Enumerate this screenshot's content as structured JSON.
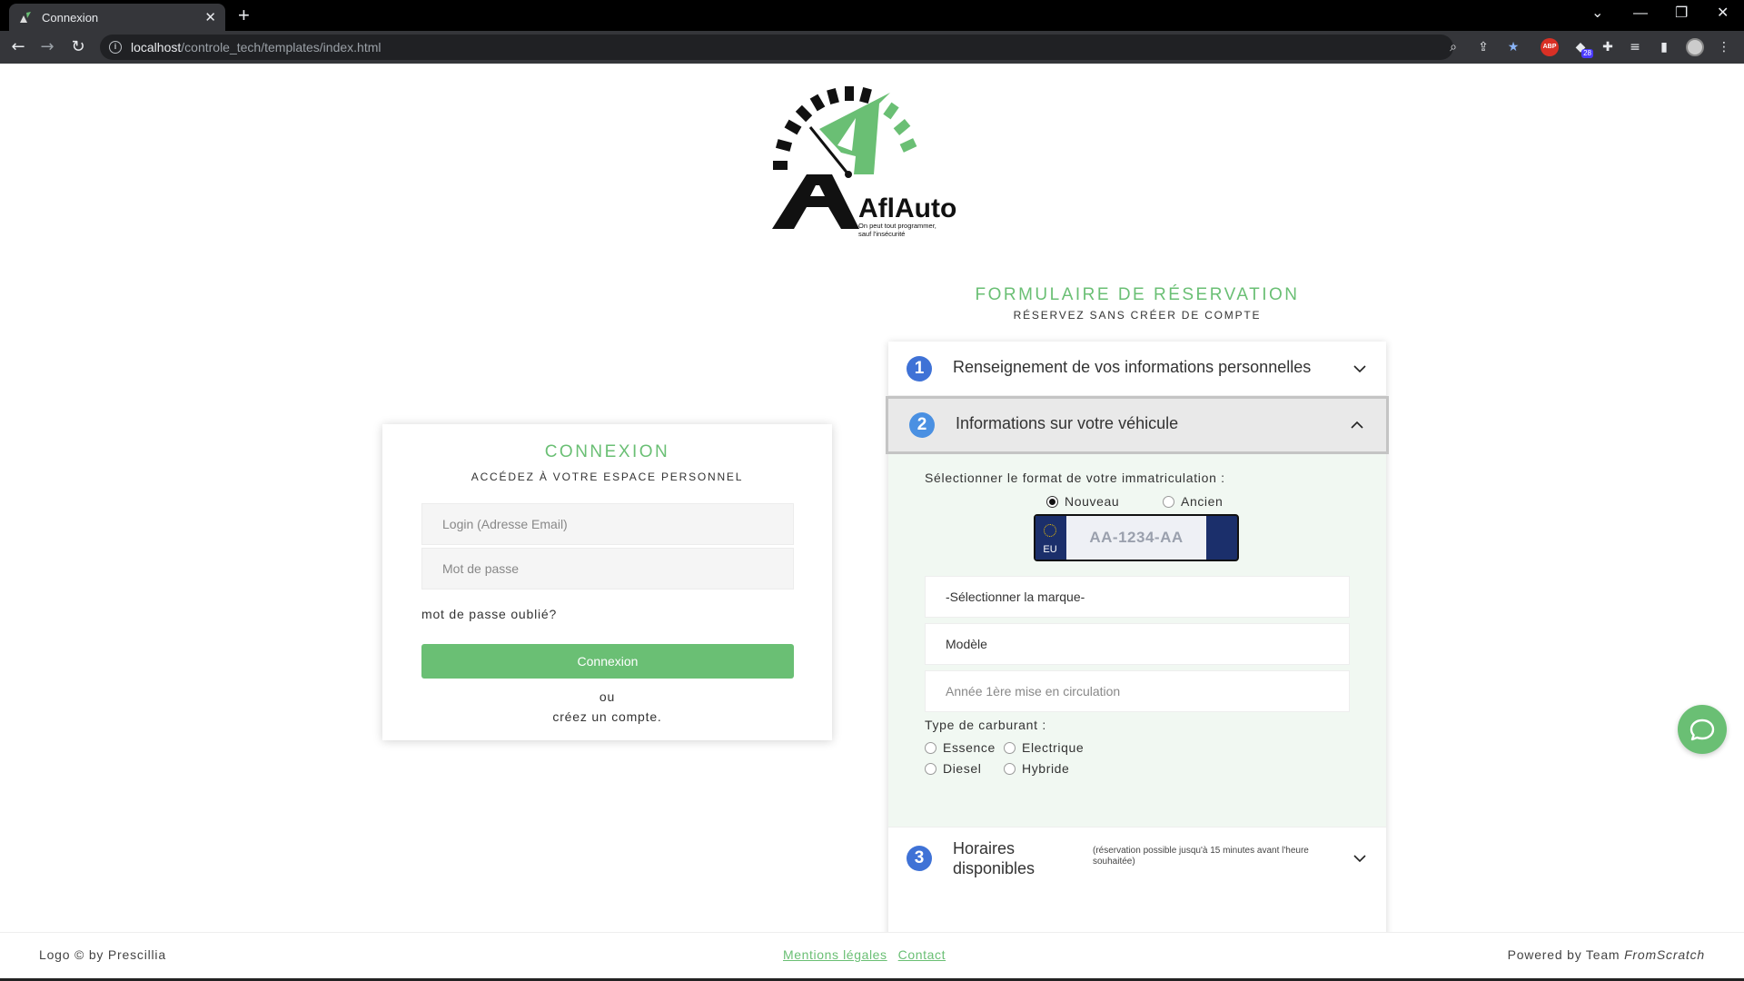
{
  "browser": {
    "tab_title": "Connexion",
    "tab_close": "✕",
    "new_tab": "+",
    "url_host": "localhost",
    "url_path": "/controle_tech/templates/index.html",
    "abp_label": "ABP",
    "ext_badge": "28"
  },
  "logo": {
    "brand": "AflAuto",
    "tagline_line1": "On peut tout programmer,",
    "tagline_line2": "sauf l'insécurité"
  },
  "login": {
    "title": "CONNEXION",
    "subtitle": "ACCÉDEZ À VOTRE ESPACE PERSONNEL",
    "login_placeholder": "Login (Adresse Email)",
    "password_placeholder": "Mot de passe",
    "forgot": "mot de passe oublié?",
    "button": "Connexion",
    "or": "ou",
    "create": "créez un compte."
  },
  "booking": {
    "title": "FORMULAIRE DE RÉSERVATION",
    "subtitle": "RÉSERVEZ SANS CRÉER DE COMPTE",
    "sections": [
      {
        "number": "1",
        "label": "Renseignement de vos informations personnelles"
      },
      {
        "number": "2",
        "label": "Informations sur votre véhicule"
      },
      {
        "number": "3",
        "label": "Horaires disponibles",
        "note": "(réservation possible jusqu'à 15 minutes avant l'heure souhaitée)"
      }
    ],
    "plate_format_label": "Sélectionner le format de votre immatriculation :",
    "plate_options": [
      {
        "label": "Nouveau",
        "checked": true
      },
      {
        "label": "Ancien",
        "checked": false
      }
    ],
    "plate_eu": "EU",
    "plate_placeholder": "AA-1234-AA",
    "brand_select": "-Sélectionner la marque-",
    "model_placeholder": "Modèle",
    "year_placeholder": "Année 1ère mise en circulation",
    "fuel_label": "Type de carburant :",
    "fuel_options": [
      "Essence",
      "Electrique",
      "Diesel",
      "Hybride"
    ]
  },
  "footer": {
    "left": "Logo © by Prescillia",
    "links": [
      "Mentions légales",
      "Contact"
    ],
    "right_prefix": "Powered by Team ",
    "right_brand": "FromScratch"
  },
  "colors": {
    "accent_green": "#6abf74",
    "step_blue": "#3f72d6",
    "plate_blue": "#1b2f6b"
  }
}
